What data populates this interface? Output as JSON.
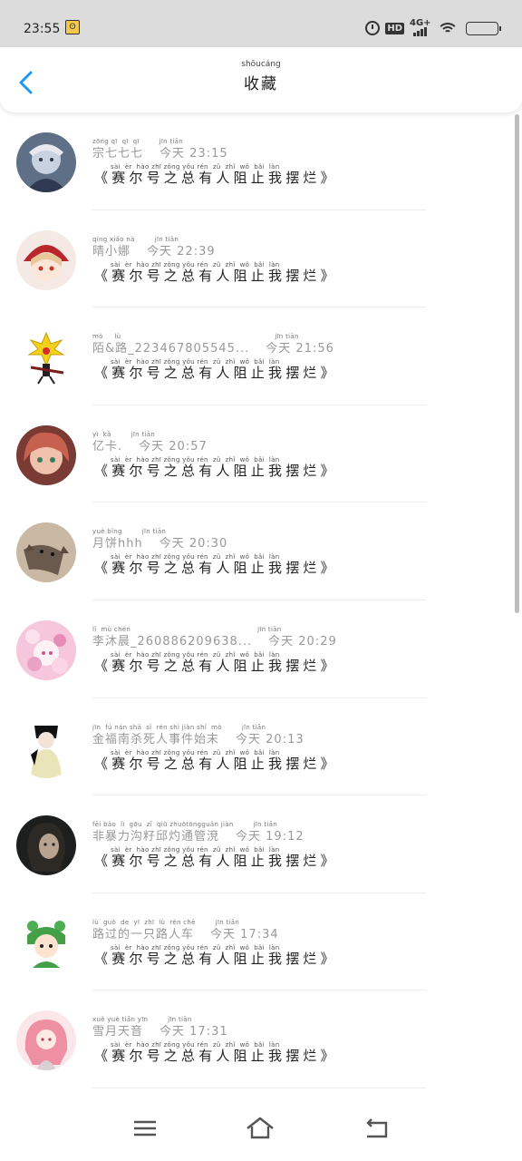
{
  "status_bar": {
    "time": "23:55",
    "notification_icon": "face-icon",
    "hd_label": "HD",
    "network_label": "4G+"
  },
  "header": {
    "title": "收藏",
    "title_pinyin": "shōucáng",
    "back_icon": "chevron-left-icon",
    "accent_color": "#2196f3"
  },
  "items": [
    {
      "name_pinyin": "zōng qī  qī  qī",
      "name": "宗七七七",
      "time_pinyin": "jīn tiān",
      "time": "今天 23:15",
      "body_pinyin": "sài  èr  hào zhī zǒng yǒu rén  zǔ  zhǐ  wǒ  bǎi  làn",
      "body": "《赛尔号之总有人阻止我摆烂》"
    },
    {
      "name_pinyin": "qíng xiǎo nà",
      "name": "晴小娜",
      "time_pinyin": "jīn tiān",
      "time": "今天 22:39",
      "body_pinyin": "sài  èr  hào zhī zǒng yǒu rén  zǔ  zhǐ  wǒ  bǎi  làn",
      "body": "《赛尔号之总有人阻止我摆烂》"
    },
    {
      "name_pinyin": "mò     lù",
      "name": "陌&路_223467805545...",
      "time_pinyin": "jīn tiān",
      "time": "今天 21:56",
      "body_pinyin": "sài  èr  hào zhī zǒng yǒu rén  zǔ  zhǐ  wǒ  bǎi  làn",
      "body": "《赛尔号之总有人阻止我摆烂》"
    },
    {
      "name_pinyin": "yì  kǎ",
      "name": "亿卡.",
      "time_pinyin": "jīn tiān",
      "time": "今天 20:57",
      "body_pinyin": "sài  èr  hào zhī zǒng yǒu rén  zǔ  zhǐ  wǒ  bǎi  làn",
      "body": "《赛尔号之总有人阻止我摆烂》"
    },
    {
      "name_pinyin": "yuè bǐng",
      "name": "月饼hhh",
      "time_pinyin": "jīn tiān",
      "time": "今天 20:30",
      "body_pinyin": "sài  èr  hào zhī zǒng yǒu rén  zǔ  zhǐ  wǒ  bǎi  làn",
      "body": "《赛尔号之总有人阻止我摆烂》"
    },
    {
      "name_pinyin": "lǐ  mù chén",
      "name": "李沐晨_260886209638...",
      "time_pinyin": "jīn tiān",
      "time": "今天 20:29",
      "body_pinyin": "sài  èr  hào zhī zǒng yǒu rén  zǔ  zhǐ  wǒ  bǎi  làn",
      "body": "《赛尔号之总有人阻止我摆烂》"
    },
    {
      "name_pinyin": "jīn  fú nán shā  sǐ  rén shì jiàn shǐ  mò",
      "name": "金福南杀死人事件始末",
      "time_pinyin": "jīn tiān",
      "time": "今天 20:13",
      "body_pinyin": "sài  èr  hào zhī zǒng yǒu rén  zǔ  zhǐ  wǒ  bǎi  làn",
      "body": "《赛尔号之总有人阻止我摆烂》"
    },
    {
      "name_pinyin": "fēi bào  lì  gōu  zǐ  qiū zhuōtōngguǎn jiàn",
      "name": "非暴力沟籽邱灼通管渷",
      "time_pinyin": "jīn tiān",
      "time": "今天 19:12",
      "body_pinyin": "sài  èr  hào zhī zǒng yǒu rén  zǔ  zhǐ  wǒ  bǎi  làn",
      "body": "《赛尔号之总有人阻止我摆烂》"
    },
    {
      "name_pinyin": "lù  guò  de  yī  zhī  lù  rén chē",
      "name": "路过的一只路人车",
      "time_pinyin": "jīn tiān",
      "time": "今天 17:34",
      "body_pinyin": "sài  èr  hào zhī zǒng yǒu rén  zǔ  zhǐ  wǒ  bǎi  làn",
      "body": "《赛尔号之总有人阻止我摆烂》"
    },
    {
      "name_pinyin": "xuě yuè tiān yīn",
      "name": "雪月天音",
      "time_pinyin": "jīn tiān",
      "time": "今天 17:31",
      "body_pinyin": "sài  èr  hào zhī zǒng yǒu rén  zǔ  zhǐ  wǒ  bǎi  làn",
      "body": "《赛尔号之总有人阻止我摆烂》"
    }
  ],
  "nav_bar": {
    "menu_icon": "menu-icon",
    "home_icon": "home-icon",
    "back_icon": "back-icon"
  }
}
